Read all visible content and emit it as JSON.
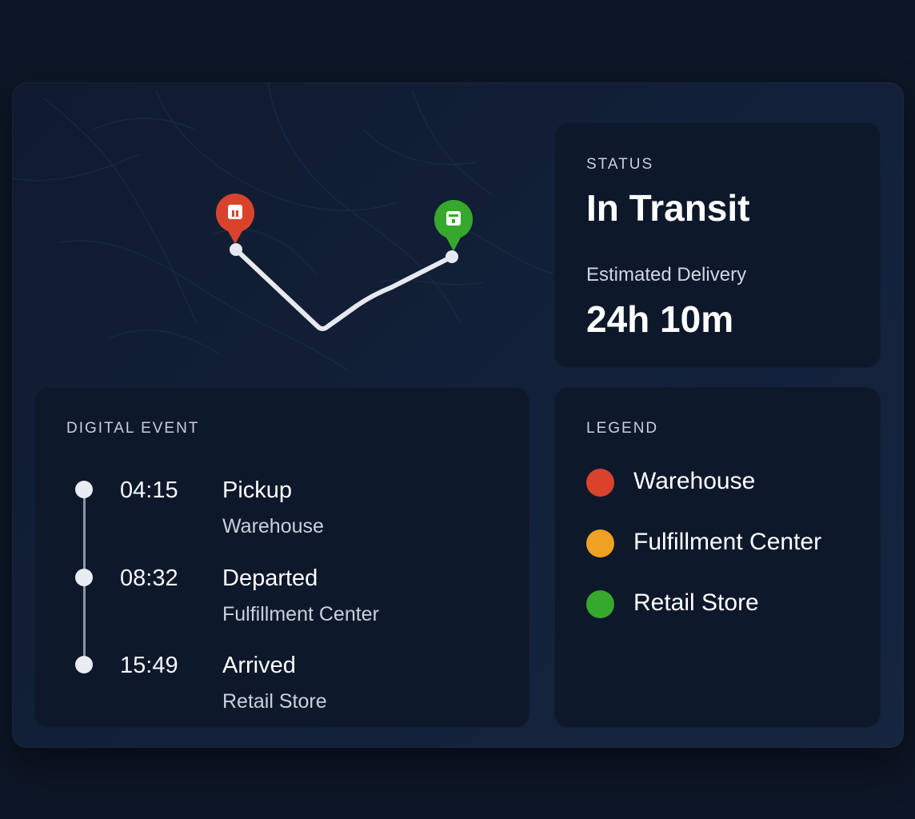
{
  "map": {
    "origin_icon": "warehouse-pin-icon",
    "destination_icon": "store-pin-icon",
    "route_color": "#e6e9ee"
  },
  "status": {
    "label": "STATUS",
    "value": "In Transit",
    "eta_label": "Estimated Delivery",
    "eta_value": "24h 10m"
  },
  "events": {
    "title": "DIGITAL EVENT",
    "items": [
      {
        "time": "04:15",
        "title": "Pickup",
        "location": "Warehouse"
      },
      {
        "time": "08:32",
        "title": "Departed",
        "location": "Fulfillment Center"
      },
      {
        "time": "15:49",
        "title": "Arrived",
        "location": "Retail Store"
      }
    ]
  },
  "legend": {
    "title": "LEGEND",
    "items": [
      {
        "label": "Warehouse",
        "color": "#d9432c"
      },
      {
        "label": "Fulfillment Center",
        "color": "#f0a022"
      },
      {
        "label": "Retail Store",
        "color": "#36a82c"
      }
    ]
  }
}
